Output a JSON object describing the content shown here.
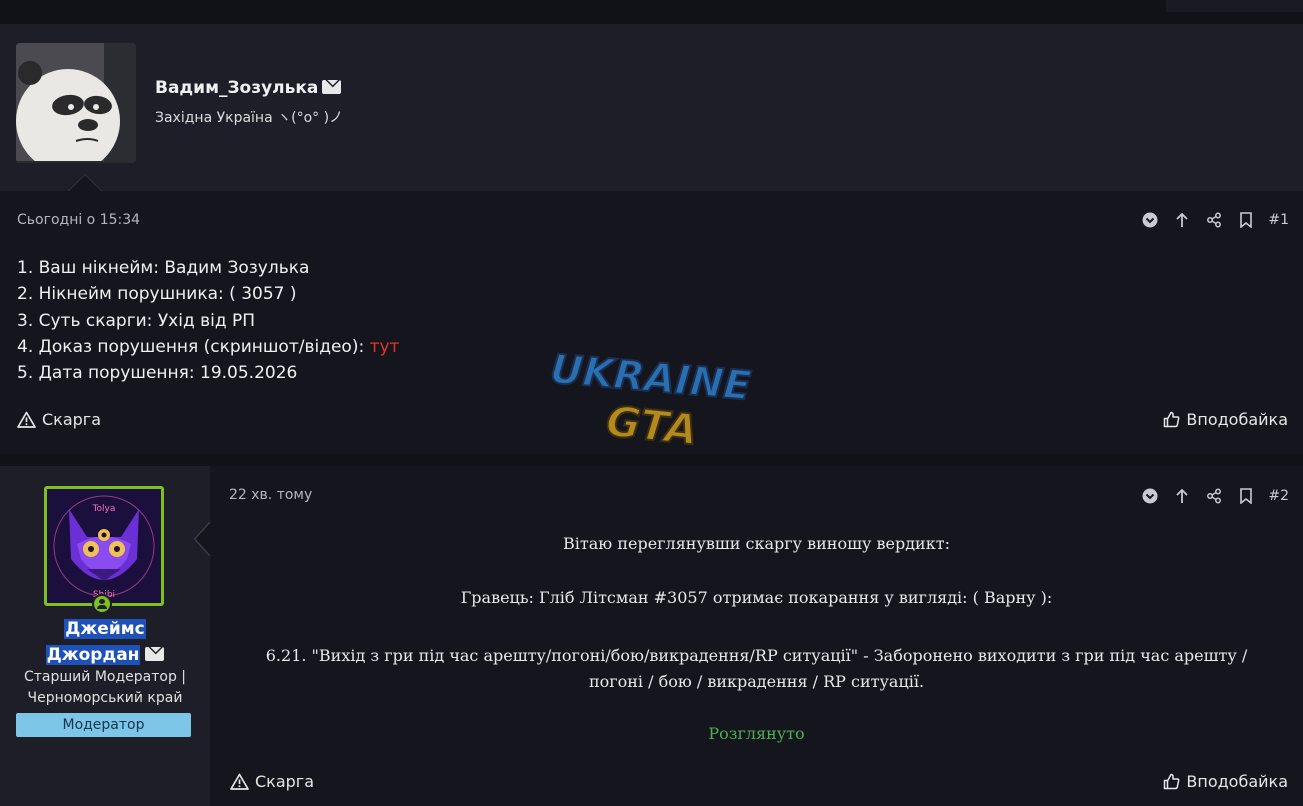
{
  "post1": {
    "username": "Вадим_Зозулька",
    "user_title": "Західна Україна ヽ(°o° )ノ",
    "date": "Сьогодні о 15:34",
    "number": "#1",
    "lines": [
      "1. Ваш нікнейм: Вадим Зозулька",
      "2. Нікнейм порушника: ( 3057 )",
      "3. Суть скарги: Ухід від РП"
    ],
    "line4_prefix": "4. Доказ порушення (скриншот/відео): ",
    "line4_link": "тут",
    "line5": "5. Дата порушення: 19.05.2026",
    "report_label": "Скарга",
    "like_label": "Вподобайка"
  },
  "watermark": {
    "line1": "UKRAINE",
    "line2": "GTA"
  },
  "post2": {
    "username_line1": "Джеймс",
    "username_line2": "Джордан",
    "title_line1": "Старший Модератор |",
    "title_line2": "Черноморський край",
    "badge": "Модератор",
    "date": "22 хв. тому",
    "number": "#2",
    "greeting": "Вітаю переглянувши скаргу виношу вердикт:",
    "verdict": "Гравець: Гліб Літсман #3057 отримає покарання у вигляді: ( Варну ):",
    "rule_line1": "6.21. \"Вихід з гри під час арешту/погоні/бою/викрадення/RP ситуації\" - Заборонено виходити з гри під час арешту /",
    "rule_line2": "погоні / бою / викрадення / RP ситуації.",
    "status": "Розглянуто",
    "report_label": "Скарга",
    "like_label": "Вподобайка"
  },
  "avatar2_text": {
    "top": "Tolya",
    "bottom": "Shibi"
  },
  "colors": {
    "link_red": "#e5332a",
    "status_green": "#4caf50",
    "badge_blue": "#7ec6e8",
    "avatar_border": "#7dc11e",
    "highlight": "#1f52b8"
  }
}
